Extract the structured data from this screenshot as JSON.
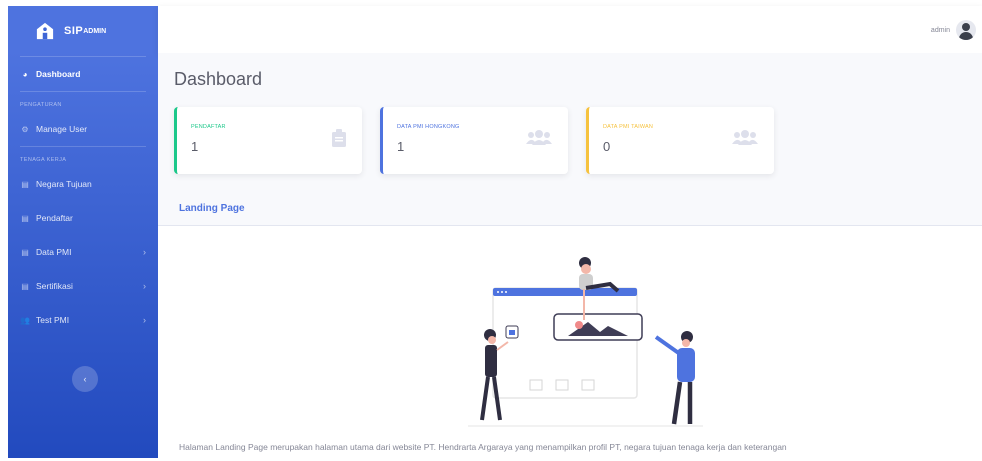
{
  "sidebar": {
    "brand": {
      "text": "SIP",
      "sub": "ADMIN"
    },
    "items": [
      {
        "label": "Dashboard",
        "icon": "dashboard-icon"
      },
      {
        "heading": "PENGATURAN"
      },
      {
        "label": "Manage User",
        "icon": "gear-icon"
      },
      {
        "heading": "TENAGA KERJA"
      },
      {
        "label": "Negara Tujuan",
        "icon": "table-icon"
      },
      {
        "label": "Pendaftar",
        "icon": "table-icon"
      },
      {
        "label": "Data PMI",
        "icon": "table-icon"
      },
      {
        "label": "Sertifikasi",
        "icon": "table-icon"
      },
      {
        "label": "Test PMI",
        "icon": "users-icon"
      }
    ]
  },
  "topbar": {
    "user_name": "admin"
  },
  "main": {
    "title": "Dashboard",
    "cards": [
      {
        "label": "PENDAFTAR",
        "value": "1",
        "color": "#1cc88a",
        "icon": "clipboard-icon"
      },
      {
        "label": "DATA PMI HONGKONG",
        "value": "1",
        "color": "#4e73df",
        "icon": "users-icon"
      },
      {
        "label": "DATA PMI TAIWAN",
        "value": "0",
        "color": "#f6c23e",
        "icon": "users-icon"
      }
    ],
    "landing": {
      "header": "Landing Page",
      "description": "Halaman Landing Page merupakan halaman utama dari website PT. Hendrarta Argaraya yang menampilkan profil PT, negara tujuan tenaga kerja dan keterangan"
    }
  },
  "colors": {
    "primary": "#4e73df",
    "success": "#1cc88a",
    "warning": "#f6c23e"
  }
}
